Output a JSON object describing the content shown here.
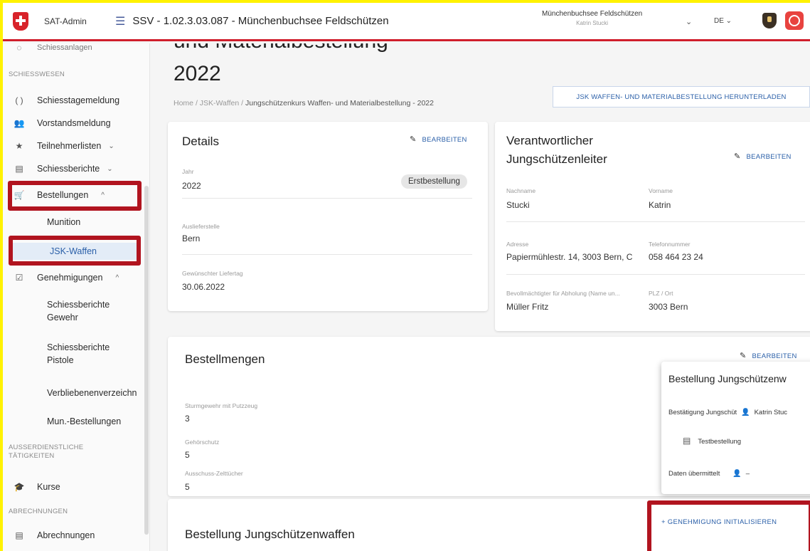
{
  "header": {
    "brand": "SAT-Admin",
    "title": "SSV - 1.02.3.03.087 - Münchenbuchsee Feldschützen",
    "user_org": "Münchenbuchsee Feldschützen",
    "user_name": "Katrin Stucki",
    "language": "DE"
  },
  "sidebar": {
    "top_cut": "Schiessanlagen",
    "section_schiesswesen": "SCHIESSWESEN",
    "schiesstagemeldung": "Schiesstagemeldung",
    "vorstandsmeldung": "Vorstandsmeldung",
    "teilnehmerlisten": "Teilnehmerlisten",
    "schiessberichte": "Schiessberichte",
    "bestellungen": "Bestellungen",
    "munition": "Munition",
    "jsk_waffen": "JSK-Waffen",
    "genehmigungen": "Genehmigungen",
    "sb_gewehr_1": "Schiessberichte",
    "sb_gewehr_2": "Gewehr",
    "sb_pistole_1": "Schiessberichte",
    "sb_pistole_2": "Pistole",
    "verbliebenen": "Verbliebenenverzeichn",
    "mun_bestellungen": "Mun.-Bestellungen",
    "section_ausser_1": "AUSSERDIENSTLICHE",
    "section_ausser_2": "TÄTIGKEITEN",
    "kurse": "Kurse",
    "section_abrechnungen": "ABRECHNUNGEN",
    "abrechnungen": "Abrechnungen"
  },
  "main": {
    "title_top": "und Materialbestellung",
    "title": "2022",
    "breadcrumb_home": "Home",
    "breadcrumb_sep": "/",
    "breadcrumb_jsk": "JSK-Waffen",
    "breadcrumb_current": "Jungschützenkurs Waffen- und Materialbestellung - 2022",
    "download_label": "JSK WAFFEN- UND MATERIALBESTELLUNG HERUNTERLADEN",
    "edit_label": "BEARBEITEN",
    "details": {
      "title": "Details",
      "chip": "Erstbestellung",
      "jahr_label": "Jahr",
      "jahr_value": "2022",
      "auslieferstelle_label": "Auslieferstelle",
      "auslieferstelle_value": "Bern",
      "liefertag_label": "Gewünschter Liefertag",
      "liefertag_value": "30.06.2022"
    },
    "leiter": {
      "title_1": "Verantwortlicher",
      "title_2": "Jungschützenleiter",
      "nachname_label": "Nachname",
      "nachname_value": "Stucki",
      "vorname_label": "Vorname",
      "vorname_value": "Katrin",
      "adresse_label": "Adresse",
      "adresse_value": "Papiermühlestr. 14, 3003 Bern, C",
      "telefon_label": "Telefonnummer",
      "telefon_value": "058 464 23 24",
      "bevoll_label": "Bevollmächtigter für Abholung (Name un...",
      "bevoll_value": "Müller Fritz",
      "plz_label": "PLZ / Ort",
      "plz_value": "3003 Bern"
    },
    "mengen": {
      "title": "Bestellmengen",
      "stgw_label": "Sturmgewehr mit Putzzeug",
      "stgw_value": "3",
      "gehoer_label": "Gehörschutz",
      "gehoer_value": "5",
      "zelt_label": "Ausschuss-Zelttücher",
      "zelt_value": "5"
    },
    "popup": {
      "title": "Bestellung Jungschützenw",
      "confirm_label": "Bestätigung Jungschüt",
      "confirm_value": "Katrin Stuc",
      "note": "Testbestellung",
      "sent_label": "Daten übermittelt",
      "sent_value": "–"
    },
    "waffen": {
      "title": "Bestellung Jungschützenwaffen",
      "genehmigung_label": "+  GENEHMIGUNG INITIALISIEREN"
    }
  },
  "colors": {
    "accent_red": "#b1141f",
    "link_blue": "#2a5fa8",
    "frame_yellow": "#fff200"
  }
}
